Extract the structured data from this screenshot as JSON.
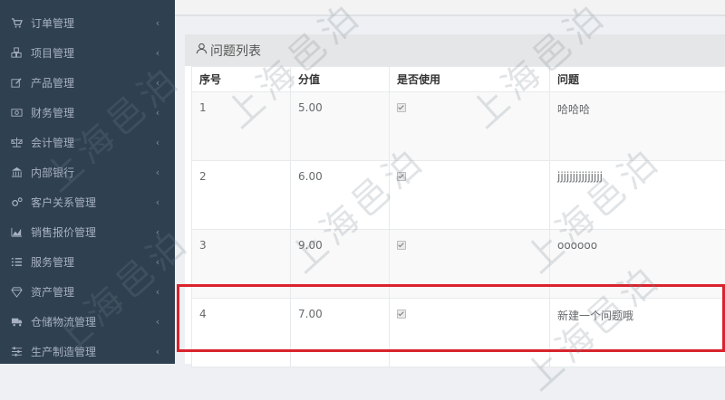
{
  "sidebar": {
    "items": [
      {
        "label": "订单管理",
        "icon": "cart-icon"
      },
      {
        "label": "项目管理",
        "icon": "cubes-icon"
      },
      {
        "label": "产品管理",
        "icon": "edit-icon"
      },
      {
        "label": "财务管理",
        "icon": "money-icon"
      },
      {
        "label": "会计管理",
        "icon": "balance-scale-icon"
      },
      {
        "label": "内部银行",
        "icon": "bank-icon"
      },
      {
        "label": "客户关系管理",
        "icon": "cogs-icon"
      },
      {
        "label": "销售报价管理",
        "icon": "area-chart-icon"
      },
      {
        "label": "服务管理",
        "icon": "list-icon"
      },
      {
        "label": "资产管理",
        "icon": "diamond-icon"
      },
      {
        "label": "仓储物流管理",
        "icon": "truck-icon"
      },
      {
        "label": "生产制造管理",
        "icon": "sliders-icon"
      }
    ],
    "chevron": "‹"
  },
  "panel": {
    "title": "问题列表",
    "title_icon": "user-icon"
  },
  "table": {
    "headers": [
      "序号",
      "分值",
      "是否使用",
      "问题"
    ],
    "rows": [
      {
        "seq": "1",
        "score": "5.00",
        "used": true,
        "question": "哈哈哈"
      },
      {
        "seq": "2",
        "score": "6.00",
        "used": true,
        "question": "jjjjjjjjjjjjjjj"
      },
      {
        "seq": "3",
        "score": "9.00",
        "used": true,
        "question": "oooooo"
      },
      {
        "seq": "4",
        "score": "7.00",
        "used": true,
        "question": "新建一个问题哦"
      }
    ]
  },
  "watermark": "上海邑泊",
  "colors": {
    "sidebar_bg": "#2f4050",
    "highlight": "#d9232d"
  }
}
